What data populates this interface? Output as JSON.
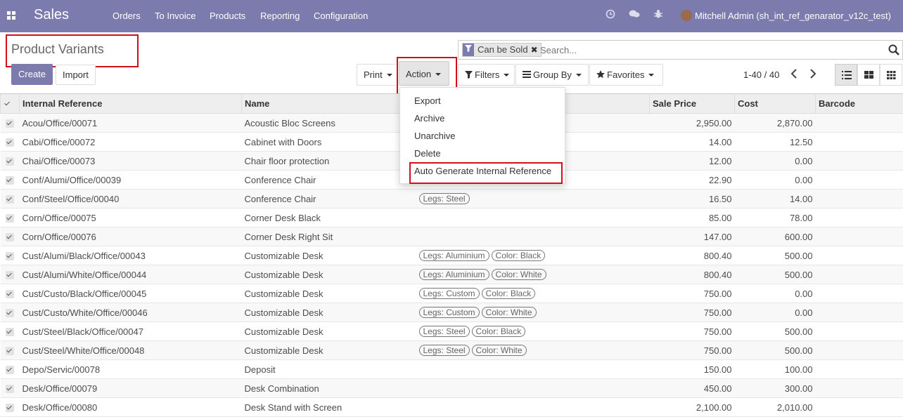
{
  "navbar": {
    "brand": "Sales",
    "menu": [
      "Orders",
      "To Invoice",
      "Products",
      "Reporting",
      "Configuration"
    ],
    "user": "Mitchell Admin (sh_int_ref_genarator_v12c_test)"
  },
  "page": {
    "title": "Product Variants"
  },
  "toolbar": {
    "create": "Create",
    "import": "Import",
    "print": "Print",
    "action": "Action",
    "filters": "Filters",
    "group_by": "Group By",
    "favorites": "Favorites"
  },
  "search": {
    "facet": "Can be Sold",
    "placeholder": "Search..."
  },
  "pager": {
    "range": "1-40 / 40"
  },
  "action_menu": [
    "Export",
    "Archive",
    "Unarchive",
    "Delete",
    "Auto Generate Internal Reference"
  ],
  "columns": [
    "Internal Reference",
    "Name",
    "Sale Price",
    "Cost",
    "Barcode"
  ],
  "rows": [
    {
      "ref": "Acou/Office/00071",
      "name": "Acoustic Bloc Screens",
      "tags": [],
      "price": "2,950.00",
      "cost": "2,870.00"
    },
    {
      "ref": "Cabi/Office/00072",
      "name": "Cabinet with Doors",
      "tags": [],
      "price": "14.00",
      "cost": "12.50"
    },
    {
      "ref": "Chai/Office/00073",
      "name": "Chair floor protection",
      "tags": [],
      "price": "12.00",
      "cost": "0.00"
    },
    {
      "ref": "Conf/Alumi/Office/00039",
      "name": "Conference Chair",
      "tags": [],
      "price": "22.90",
      "cost": "0.00"
    },
    {
      "ref": "Conf/Steel/Office/00040",
      "name": "Conference Chair",
      "tags": [
        "Legs: Steel"
      ],
      "price": "16.50",
      "cost": "14.00"
    },
    {
      "ref": "Corn/Office/00075",
      "name": "Corner Desk Black",
      "tags": [],
      "price": "85.00",
      "cost": "78.00"
    },
    {
      "ref": "Corn/Office/00076",
      "name": "Corner Desk Right Sit",
      "tags": [],
      "price": "147.00",
      "cost": "600.00"
    },
    {
      "ref": "Cust/Alumi/Black/Office/00043",
      "name": "Customizable Desk",
      "tags": [
        "Legs: Aluminium",
        "Color: Black"
      ],
      "price": "800.40",
      "cost": "500.00"
    },
    {
      "ref": "Cust/Alumi/White/Office/00044",
      "name": "Customizable Desk",
      "tags": [
        "Legs: Aluminium",
        "Color: White"
      ],
      "price": "800.40",
      "cost": "500.00"
    },
    {
      "ref": "Cust/Custo/Black/Office/00045",
      "name": "Customizable Desk",
      "tags": [
        "Legs: Custom",
        "Color: Black"
      ],
      "price": "750.00",
      "cost": "0.00"
    },
    {
      "ref": "Cust/Custo/White/Office/00046",
      "name": "Customizable Desk",
      "tags": [
        "Legs: Custom",
        "Color: White"
      ],
      "price": "750.00",
      "cost": "0.00"
    },
    {
      "ref": "Cust/Steel/Black/Office/00047",
      "name": "Customizable Desk",
      "tags": [
        "Legs: Steel",
        "Color: Black"
      ],
      "price": "750.00",
      "cost": "500.00"
    },
    {
      "ref": "Cust/Steel/White/Office/00048",
      "name": "Customizable Desk",
      "tags": [
        "Legs: Steel",
        "Color: White"
      ],
      "price": "750.00",
      "cost": "500.00"
    },
    {
      "ref": "Depo/Servic/00078",
      "name": "Deposit",
      "tags": [],
      "price": "150.00",
      "cost": "100.00"
    },
    {
      "ref": "Desk/Office/00079",
      "name": "Desk Combination",
      "tags": [],
      "price": "450.00",
      "cost": "300.00"
    },
    {
      "ref": "Desk/Office/00080",
      "name": "Desk Stand with Screen",
      "tags": [],
      "price": "2,100.00",
      "cost": "2,010.00"
    }
  ]
}
